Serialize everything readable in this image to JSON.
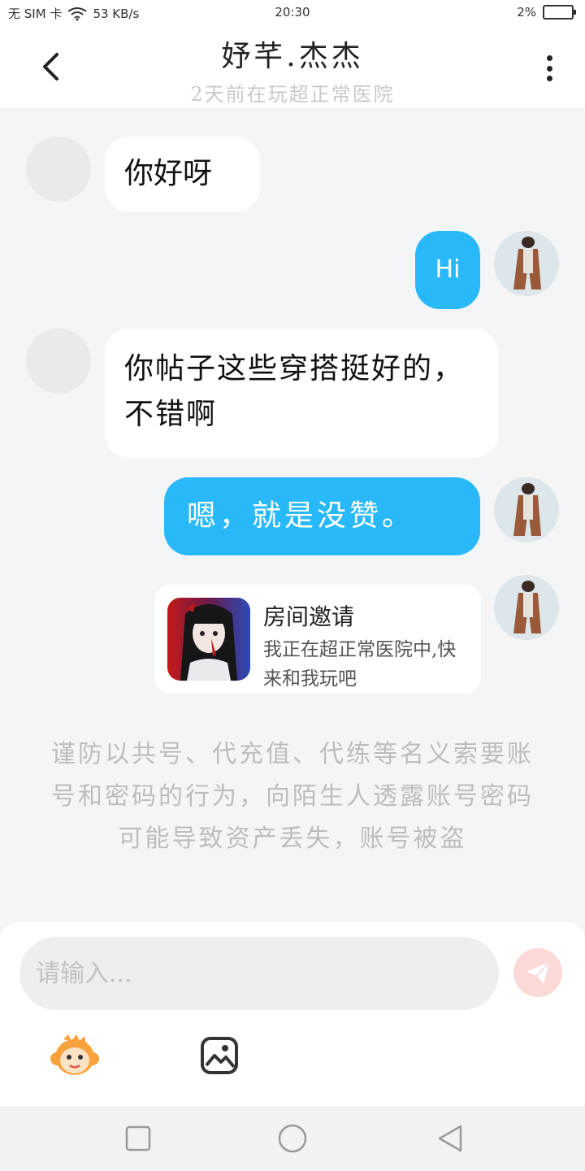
{
  "status_bar": {
    "carrier": "无 SIM 卡",
    "speed": "53 KB/s",
    "time": "20:30",
    "battery": "2%"
  },
  "header": {
    "title": "妤芊.杰杰",
    "subtitle": "2天前在玩超正常医院"
  },
  "messages": [
    {
      "side": "left",
      "text": "你好呀"
    },
    {
      "side": "right",
      "text": "Hi"
    },
    {
      "side": "left",
      "text": "你帖子这些穿搭挺好的，不错啊"
    },
    {
      "side": "right",
      "text": "嗯，就是没赞。"
    }
  ],
  "invite_card": {
    "title": "房间邀请",
    "description": "我正在超正常医院中,快来和我玩吧"
  },
  "warning": "谨防以共号、代充值、代练等名义索要账号和密码的行为，向陌生人透露账号密码可能导致资产丢失，账号被盗",
  "input": {
    "placeholder": "请输入..."
  },
  "colors": {
    "outgoing_bubble": "#29b9fb",
    "incoming_bubble": "#ffffff",
    "background": "#f4f5f7",
    "send_button": "#fbd9d6"
  },
  "icons": {
    "back": "chevron-left-icon",
    "more": "more-vertical-icon",
    "send": "paper-plane-icon",
    "emoji": "monkey-emoji-icon",
    "image": "image-icon",
    "nav_square": "recent-apps-icon",
    "nav_circle": "home-icon",
    "nav_triangle": "back-triangle-icon"
  }
}
